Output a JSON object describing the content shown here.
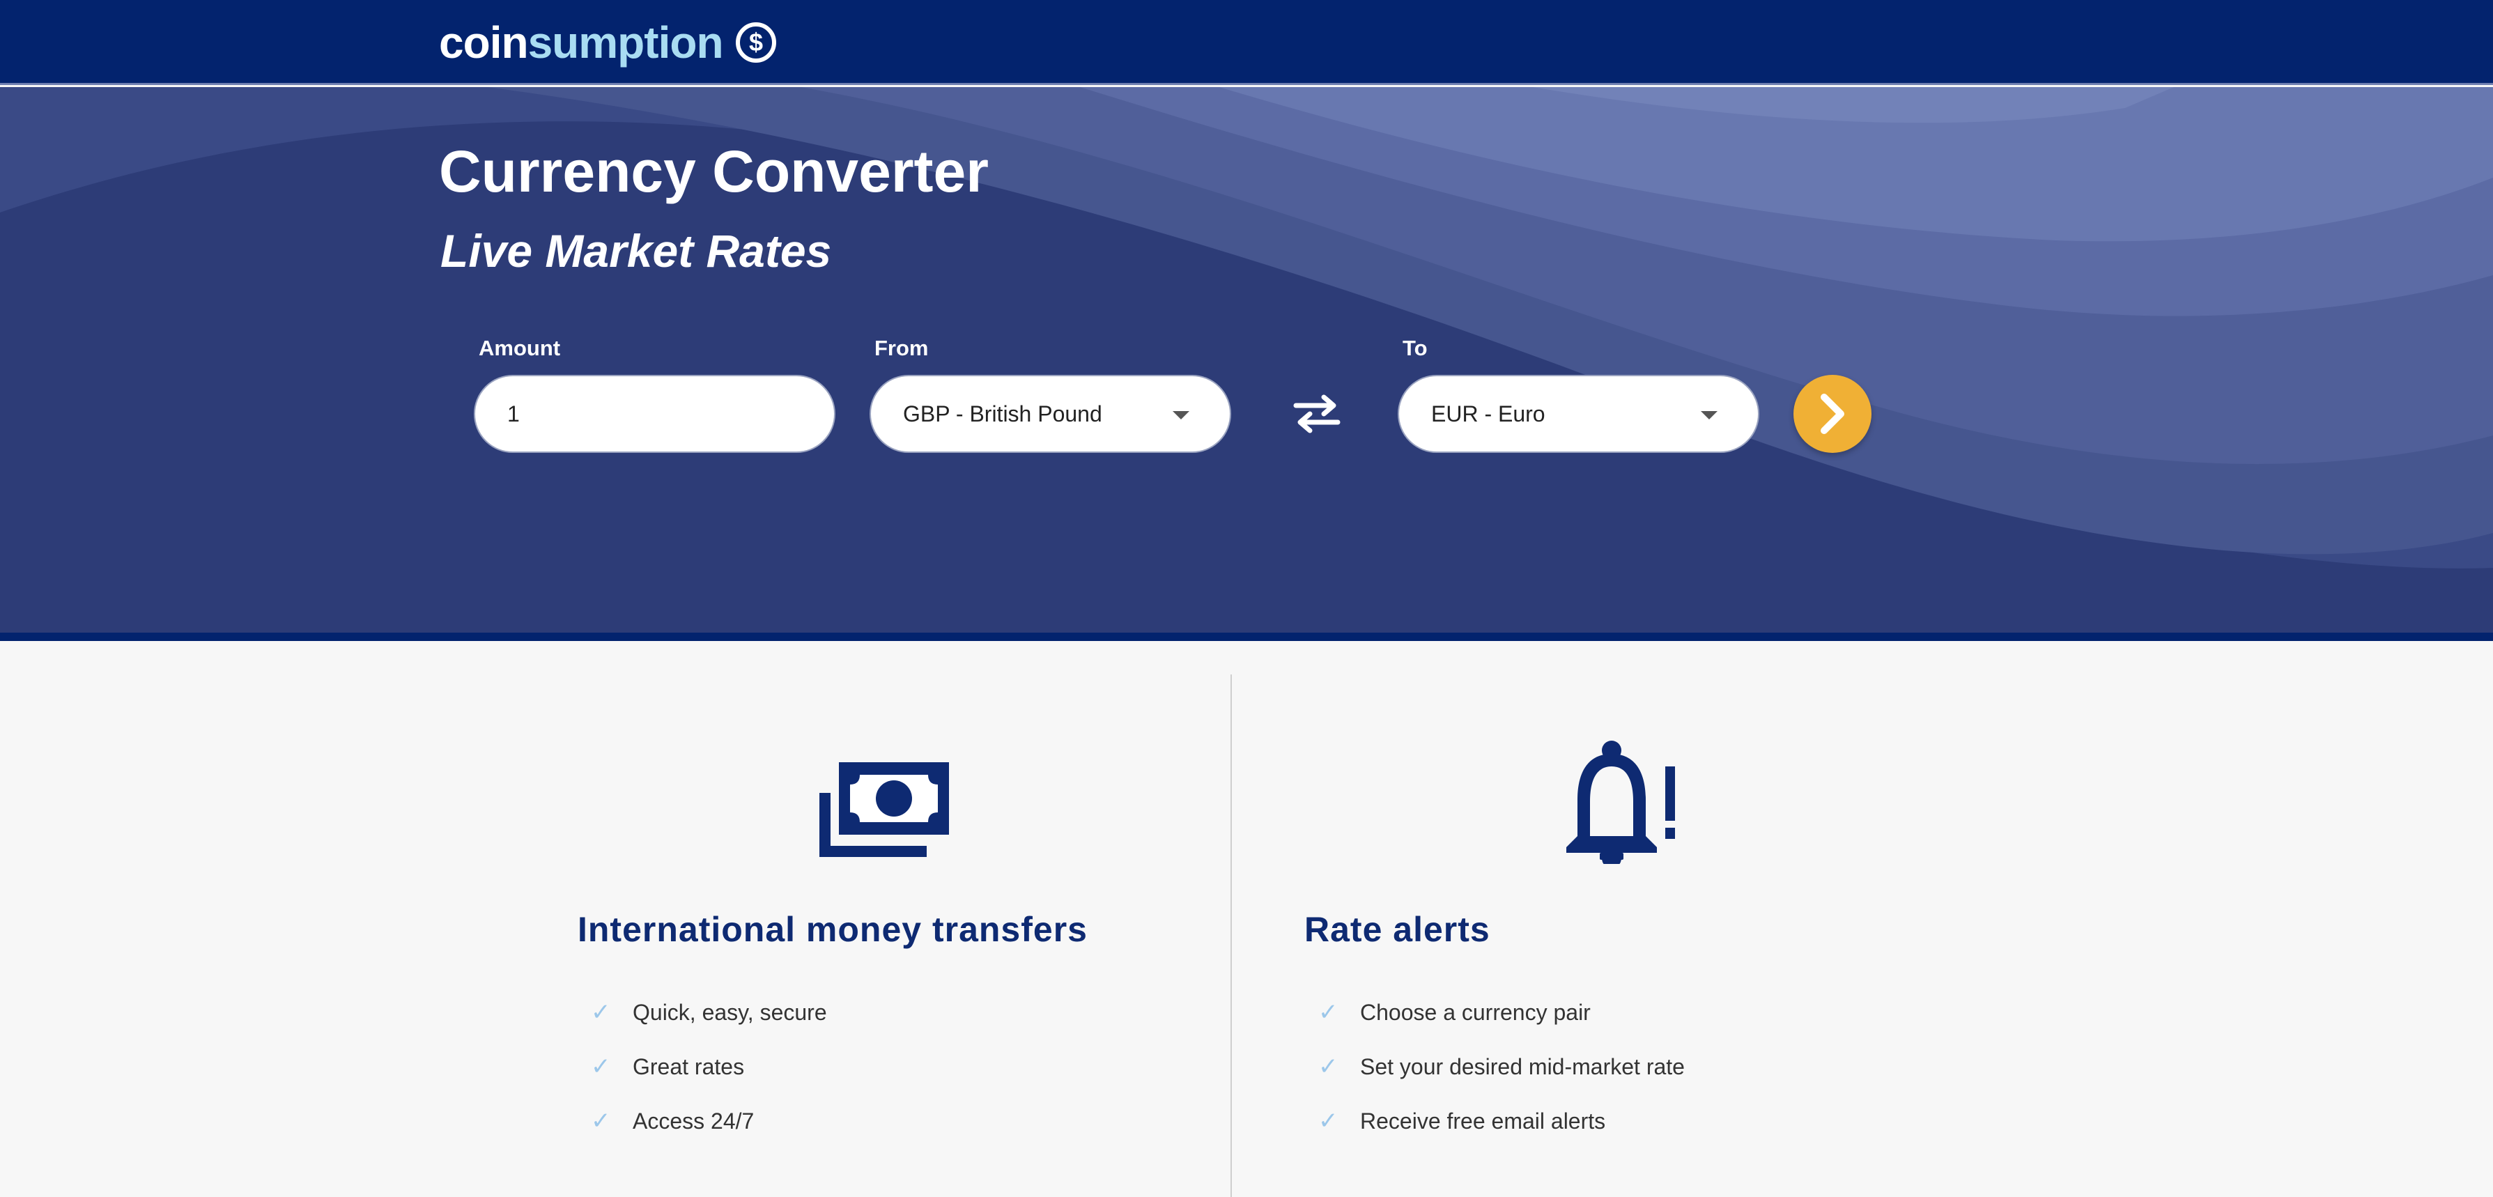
{
  "brand": {
    "name_part1": "coin",
    "name_part2": "sumption",
    "icon": "dollar-circle-icon",
    "icon_glyph": "$"
  },
  "hero": {
    "title": "Currency Converter",
    "subtitle": "Live Market Rates"
  },
  "converter": {
    "amount_label": "Amount",
    "amount_value": "1",
    "from_label": "From",
    "from_value": "GBP - British Pound",
    "to_label": "To",
    "to_value": "EUR - Euro",
    "swap_icon": "swap-arrows-icon",
    "submit_icon": "chevron-right-icon"
  },
  "features": [
    {
      "icon": "money-bill-icon",
      "title": "International money transfers",
      "items": [
        "Quick, easy, secure",
        "Great rates",
        "Access 24/7"
      ]
    },
    {
      "icon": "bell-alert-icon",
      "title": "Rate alerts",
      "items": [
        "Choose a currency pair",
        "Set your desired mid-market rate",
        "Receive free email alerts"
      ]
    }
  ],
  "check_glyph": "✓",
  "colors": {
    "header_bg": "#03236e",
    "brand_accent": "#a9dcf2",
    "hero_bg": "#2d3c77",
    "button_accent": "#f0b035",
    "feature_title": "#0e2a72",
    "check": "#9cc7ea"
  }
}
